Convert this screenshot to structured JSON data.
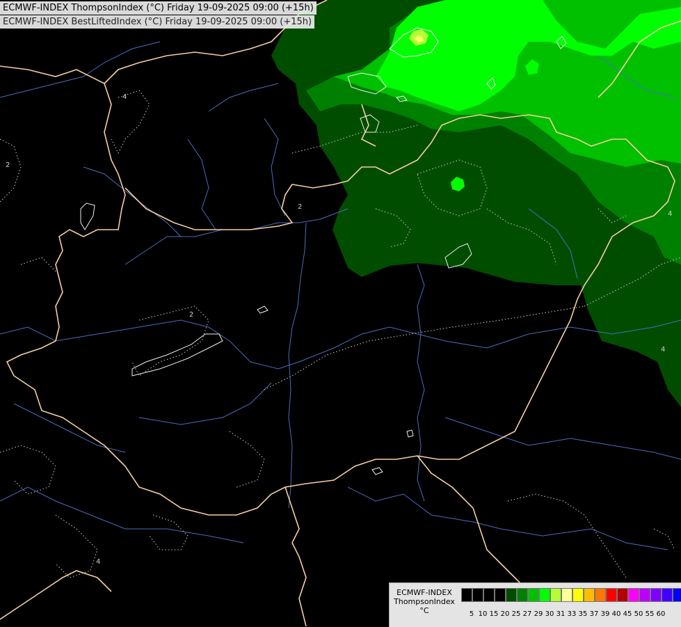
{
  "header": {
    "line1": "ECMWF-INDEX ThompsonIndex (°C) Friday 19-09-2025 09:00 (+15h)",
    "line2": "ECMWF-INDEX BestLiftedIndex (°C) Friday 19-09-2025 09:00 (+15h)"
  },
  "legend": {
    "model": "ECMWF-INDEX",
    "parameter": "ThompsonIndex",
    "unit": "°C",
    "ticks": [
      "5",
      "10",
      "15",
      "20",
      "25",
      "27",
      "29",
      "30",
      "31",
      "33",
      "35",
      "37",
      "39",
      "40",
      "45",
      "50",
      "55",
      "60"
    ],
    "colors": [
      "#000000",
      "#000000",
      "#000000",
      "#000000",
      "#004d00",
      "#008000",
      "#00c000",
      "#00ff00",
      "#b3ff33",
      "#ffff99",
      "#ffff00",
      "#ffbb00",
      "#ff7700",
      "#ff0000",
      "#b30000",
      "#ff00ff",
      "#bb00ff",
      "#8000ff",
      "#4000ff",
      "#0000ff"
    ]
  },
  "map": {
    "contour_labels": [
      "4",
      "2",
      "2",
      "2",
      "4",
      "4",
      "4"
    ],
    "colors": {
      "background": "#000000",
      "level_25": "#004d00",
      "level_27": "#008000",
      "level_29": "#00c000",
      "level_30": "#00ff00",
      "level_31": "#b3ff33",
      "level_33": "#ffff99",
      "border": "#f5cfa0",
      "river": "#4a6dbf",
      "isoline": "#cfcfcf"
    }
  }
}
